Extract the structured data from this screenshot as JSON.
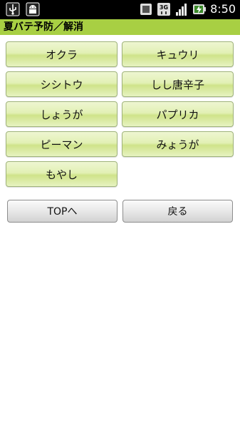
{
  "status_bar": {
    "icons_left": [
      "usb-icon",
      "android-debug-icon"
    ],
    "icons_right": [
      "sim-icon",
      "3g-icon",
      "signal-icon",
      "battery-charging-icon"
    ],
    "network_label": "3G",
    "time": "8:50"
  },
  "title_bar": {
    "title": "夏バテ予防／解消",
    "accent_color": "#a8cf43"
  },
  "items": [
    {
      "label": "オクラ"
    },
    {
      "label": "キュウリ"
    },
    {
      "label": "シシトウ"
    },
    {
      "label": "しし唐辛子"
    },
    {
      "label": "しょうが"
    },
    {
      "label": "パプリカ"
    },
    {
      "label": "ピーマン"
    },
    {
      "label": "みょうが"
    },
    {
      "label": "もやし"
    }
  ],
  "nav": {
    "top_label": "TOPへ",
    "back_label": "戻る"
  }
}
